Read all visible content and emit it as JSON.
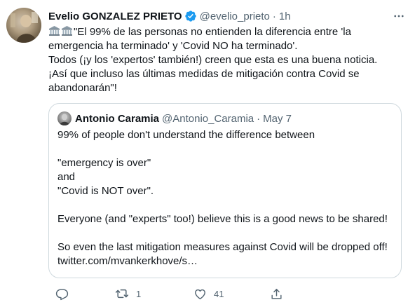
{
  "tweet": {
    "author": {
      "display_name": "Evelio GONZALEZ PRIETO",
      "handle": "@evelio_prieto",
      "verified": true
    },
    "separator": "·",
    "time": "1h",
    "more_icon": "more-horizontal-icon",
    "emoji": [
      "classical-building-emoji",
      "classical-building-emoji"
    ],
    "text_lines": [
      "\"El 99% de las personas no entienden la diferencia entre 'la",
      "emergencia ha terminado' y 'Covid NO ha terminado'.",
      "Todos (¡y los 'expertos' también!) creen que esta es una buena noticia.",
      "¡Así que incluso las últimas medidas de mitigación contra Covid se",
      "abandonarán\"!"
    ]
  },
  "quote": {
    "author": {
      "display_name": "Antonio Caramia",
      "handle": "@Antonio_Caramia"
    },
    "separator": "·",
    "date": "May 7",
    "text_lines": [
      "99% of people don't understand the difference between",
      "",
      "\"emergency is over\"",
      "and",
      "\"Covid is NOT over\".",
      "",
      "Everyone (and \"experts\" too!) believe this is a good news to be shared!",
      "",
      "So even the last mitigation measures against Covid will be dropped off!",
      "twitter.com/mvankerkhove/s…"
    ]
  },
  "actions": {
    "reply": {
      "icon": "reply-icon",
      "count": ""
    },
    "retweet": {
      "icon": "retweet-icon",
      "count": "1"
    },
    "like": {
      "icon": "heart-icon",
      "count": "41"
    },
    "share": {
      "icon": "share-icon",
      "count": ""
    }
  },
  "colors": {
    "text": "#0f1419",
    "secondary": "#536471",
    "border": "#cfd9de",
    "verified": "#1d9bf0"
  }
}
